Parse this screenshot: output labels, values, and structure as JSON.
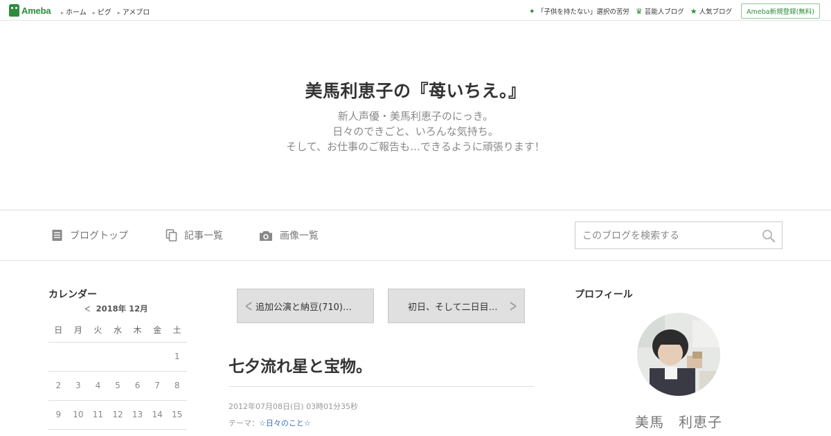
{
  "topbar": {
    "logo": "Ameba",
    "nav": [
      "ホーム",
      "ピグ",
      "アメブロ"
    ],
    "links": [
      {
        "icon": "sparkle-icon",
        "label": "「子供を持たない」選択の苦労"
      },
      {
        "icon": "crown-icon",
        "label": "芸能人ブログ"
      },
      {
        "icon": "star-icon",
        "label": "人気ブログ"
      }
    ],
    "register": "Ameba新規登録(無料)"
  },
  "header": {
    "title": "美馬利恵子の『苺いちえ。』",
    "description": [
      "新人声優・美馬利恵子のにっき。",
      "日々のできごと、いろんな気持ち。",
      "そして、お仕事のご報告も…できるように頑張ります！"
    ]
  },
  "nav": {
    "items": [
      {
        "icon": "document-icon",
        "label": "ブログトップ"
      },
      {
        "icon": "copy-icon",
        "label": "記事一覧"
      },
      {
        "icon": "camera-icon",
        "label": "画像一覧"
      }
    ],
    "search_placeholder": "このブログを検索する"
  },
  "calendar": {
    "title": "カレンダー",
    "month": "2018年 12月",
    "weekdays": [
      "日",
      "月",
      "火",
      "水",
      "木",
      "金",
      "土"
    ],
    "rows": [
      [
        "",
        "",
        "",
        "",
        "",
        "",
        "1"
      ],
      [
        "2",
        "3",
        "4",
        "5",
        "6",
        "7",
        "8"
      ],
      [
        "9",
        "10",
        "11",
        "12",
        "13",
        "14",
        "15"
      ]
    ]
  },
  "article": {
    "prev": "追加公演と納豆(710)…",
    "next": "初日、そして二日目…",
    "title": "七夕流れ星と宝物。",
    "date": "2012年07月08日(日) 03時01分35秒",
    "theme_label": "テーマ：",
    "theme": "☆日々のこと☆"
  },
  "profile": {
    "title": "プロフィール",
    "name": "美馬　利恵子"
  },
  "colors": {
    "brand": "#2d8c3c",
    "link": "#3a6fb0",
    "pager_bg": "#e0e0e0"
  }
}
